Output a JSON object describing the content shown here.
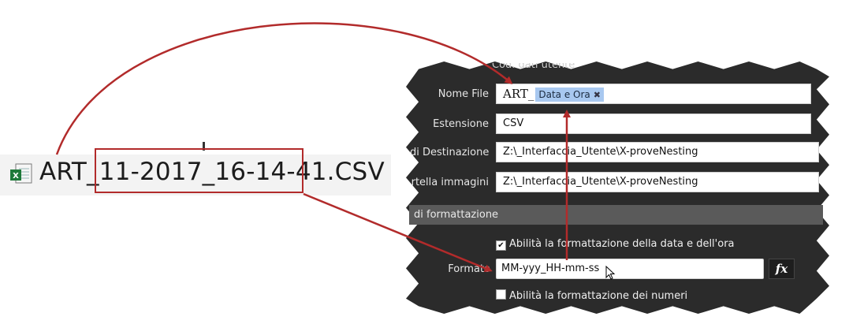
{
  "file": {
    "name": "ART_11-2017_16-14-41.CSV",
    "icon": "excel-csv-icon"
  },
  "panel": {
    "top_partial_label": "Cod. dati utente",
    "fields": {
      "nome_file": {
        "label": "Nome File",
        "prefix": "ART_",
        "tag": "Data e Ora",
        "tag_remove": "✖"
      },
      "estensione": {
        "label": "Estensione",
        "value": "CSV"
      },
      "destinazione": {
        "label": "di Destinazione",
        "value": "Z:\\_Interfaccia_Utente\\X-proveNesting"
      },
      "cartella_immagini": {
        "label": "rtella immagini",
        "value": "Z:\\_Interfaccia_Utente\\X-proveNesting"
      }
    },
    "section_title": "di formattazione",
    "enable_datetime": {
      "label": "Abilità la formattazione della data e dell'ora",
      "checked": true,
      "mark": "✔"
    },
    "formato": {
      "label": "Formato",
      "value": "MM-yyy_HH-mm-ss"
    },
    "fx_label": "fx",
    "enable_numbers": {
      "label": "Abilità la formattazione dei numeri",
      "checked": false
    }
  },
  "colors": {
    "annotation_red": "#b22b2b",
    "panel_bg": "#2b2b2b",
    "tag_bg": "#a8c8f0"
  }
}
